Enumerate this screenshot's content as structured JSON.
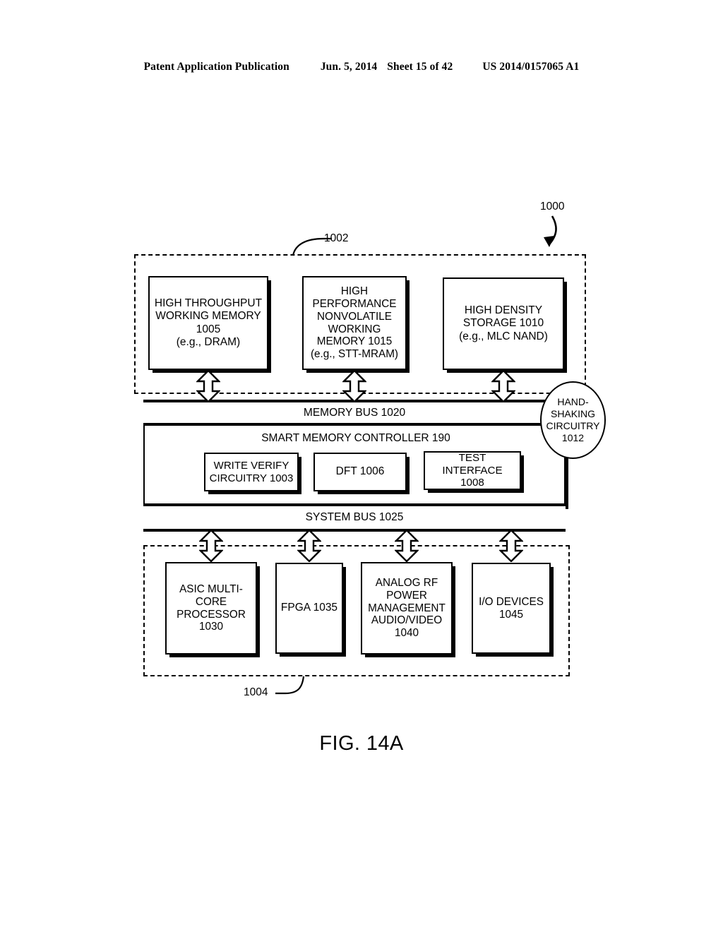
{
  "header": {
    "publication": "Patent Application Publication",
    "date": "Jun. 5, 2014",
    "sheet": "Sheet 15 of 42",
    "doc_number": "US 2014/0157065 A1"
  },
  "figure": {
    "caption": "FIG. 14A",
    "system_ref": "1000",
    "memory_group_ref": "1002",
    "device_group_ref": "1004"
  },
  "memory_blocks": [
    {
      "id": "1005",
      "label": "HIGH THROUGHPUT\nWORKING MEMORY\n1005\n(e.g., DRAM)"
    },
    {
      "id": "1015",
      "label": "HIGH\nPERFORMANCE\nNONVOLATILE\nWORKING\nMEMORY 1015\n(e.g., STT-MRAM)"
    },
    {
      "id": "1010",
      "label": "HIGH DENSITY\nSTORAGE 1010\n(e.g., MLC NAND)"
    }
  ],
  "memory_bus": {
    "label": "MEMORY BUS 1020"
  },
  "controller": {
    "label": "SMART MEMORY CONTROLLER 190",
    "blocks": [
      {
        "id": "1003",
        "label": "WRITE VERIFY\nCIRCUITRY 1003"
      },
      {
        "id": "1006",
        "label": "DFT 1006"
      },
      {
        "id": "1008",
        "label": "TEST INTERFACE\n1008"
      }
    ]
  },
  "handshaking": {
    "label": "HAND-\nSHAKING\nCIRCUITRY\n1012"
  },
  "system_bus": {
    "label": "SYSTEM BUS 1025"
  },
  "device_blocks": [
    {
      "id": "1030",
      "label": "ASIC MULTI-\nCORE\nPROCESSOR\n1030"
    },
    {
      "id": "1035",
      "label": "FPGA 1035"
    },
    {
      "id": "1040",
      "label": "ANALOG RF\nPOWER\nMANAGEMENT\nAUDIO/VIDEO\n1040"
    },
    {
      "id": "1045",
      "label": "I/O DEVICES\n1045"
    }
  ],
  "colors": {
    "ink": "#000000",
    "paper": "#ffffff"
  }
}
